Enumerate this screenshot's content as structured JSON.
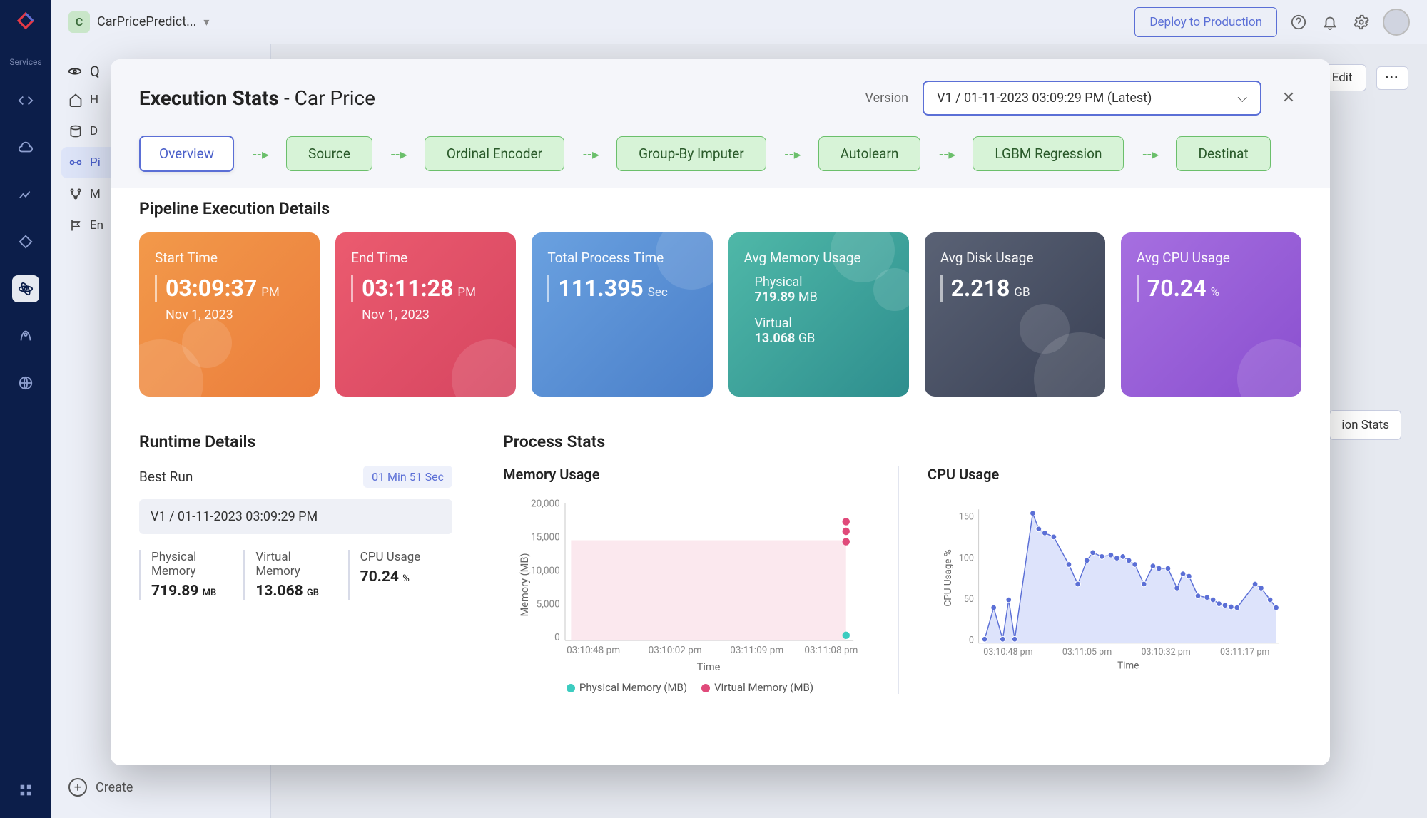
{
  "rail": {
    "services_label": "Services"
  },
  "topbar": {
    "project_initial": "C",
    "project_name": "CarPricePredict...",
    "deploy_label": "Deploy to Production"
  },
  "secnav": {
    "title": "Q",
    "items": [
      {
        "icon": "home",
        "label": "H"
      },
      {
        "icon": "data",
        "label": "D"
      },
      {
        "icon": "pipeline",
        "label": "Pi",
        "active": true
      },
      {
        "icon": "model",
        "label": "M"
      },
      {
        "icon": "endpoint",
        "label": "En"
      }
    ],
    "create_label": "Create"
  },
  "bg_controls": {
    "edit_label": "Edit",
    "stats_label": "ion Stats"
  },
  "modal": {
    "title_prefix": "Execution Stats",
    "title_suffix": "Car Price",
    "version_label": "Version",
    "version_value": "V1 / 01-11-2023 03:09:29 PM (Latest)",
    "tab_overview": "Overview",
    "pipeline": [
      "Source",
      "Ordinal Encoder",
      "Group-By Imputer",
      "Autolearn",
      "LGBM Regression",
      "Destinat"
    ],
    "section_title": "Pipeline Execution Details",
    "metrics": {
      "start": {
        "label": "Start Time",
        "value": "03:09:37",
        "unit": "PM",
        "sub": "Nov 1, 2023"
      },
      "end": {
        "label": "End Time",
        "value": "03:11:28",
        "unit": "PM",
        "sub": "Nov 1, 2023"
      },
      "process": {
        "label": "Total Process Time",
        "value": "111.395",
        "unit": "Sec"
      },
      "memory": {
        "label": "Avg Memory Usage",
        "phys_label": "Physical",
        "phys_value": "719.89",
        "phys_unit": "MB",
        "virt_label": "Virtual",
        "virt_value": "13.068",
        "virt_unit": "GB"
      },
      "disk": {
        "label": "Avg Disk Usage",
        "value": "2.218",
        "unit": "GB"
      },
      "cpu": {
        "label": "Avg CPU Usage",
        "value": "70.24",
        "unit": "%"
      }
    },
    "runtime": {
      "title": "Runtime Details",
      "best_run_label": "Best Run",
      "best_run_value": "01 Min 51 Sec",
      "version_chip": "V1 / 01-11-2023 03:09:29 PM",
      "phys_label": "Physical Memory",
      "phys_value": "719.89",
      "phys_unit": "MB",
      "virt_label": "Virtual Memory",
      "virt_value": "13.068",
      "virt_unit": "GB",
      "cpu_label": "CPU Usage",
      "cpu_value": "70.24",
      "cpu_unit": "%"
    },
    "process_stats": {
      "title": "Process Stats",
      "memory_title": "Memory Usage",
      "cpu_title": "CPU Usage",
      "legend_phys": "Physical Memory (MB)",
      "legend_virt": "Virtual Memory (MB)",
      "xlabel": "Time",
      "mem_ylabel": "Memory (MB)",
      "cpu_ylabel": "CPU Usage %"
    }
  },
  "chart_data": [
    {
      "type": "scatter",
      "title": "Memory Usage",
      "xlabel": "Time",
      "ylabel": "Memory (MB)",
      "x_categories": [
        "03:10:48 pm",
        "03:10:02 pm",
        "03:11:09 pm",
        "03:11:08 pm"
      ],
      "ylim": [
        0,
        20000
      ],
      "yticks": [
        0,
        5000,
        10000,
        15000,
        20000
      ],
      "series": [
        {
          "name": "Physical Memory (MB)",
          "color": "#3cccc0",
          "points": [
            {
              "x": "03:11:08 pm",
              "y": 700
            }
          ]
        },
        {
          "name": "Virtual Memory (MB)",
          "color": "#e04a7a",
          "points": [
            {
              "x": "03:11:08 pm",
              "y": 17500
            },
            {
              "x": "03:11:08 pm",
              "y": 16500
            },
            {
              "x": "03:11:08 pm",
              "y": 15000
            }
          ]
        }
      ],
      "shaded_region": {
        "x_from": "03:10:48 pm",
        "x_to": "03:11:08 pm",
        "y_from": 0,
        "y_to": 15000,
        "color": "#fbe8ee"
      }
    },
    {
      "type": "scatter",
      "title": "CPU Usage",
      "xlabel": "Time",
      "ylabel": "CPU Usage %",
      "x_categories": [
        "03:10:48 pm",
        "03:11:05 pm",
        "03:10:32 pm",
        "03:11:17 pm"
      ],
      "ylim": [
        0,
        170
      ],
      "yticks": [
        0,
        50,
        100,
        150
      ],
      "series": [
        {
          "name": "CPU Usage %",
          "color": "#5b6fd6",
          "points": [
            {
              "x": 0.02,
              "y": 5
            },
            {
              "x": 0.05,
              "y": 45
            },
            {
              "x": 0.08,
              "y": 5
            },
            {
              "x": 0.1,
              "y": 55
            },
            {
              "x": 0.12,
              "y": 5
            },
            {
              "x": 0.18,
              "y": 165
            },
            {
              "x": 0.2,
              "y": 145
            },
            {
              "x": 0.22,
              "y": 140
            },
            {
              "x": 0.25,
              "y": 135
            },
            {
              "x": 0.3,
              "y": 100
            },
            {
              "x": 0.33,
              "y": 75
            },
            {
              "x": 0.36,
              "y": 105
            },
            {
              "x": 0.38,
              "y": 115
            },
            {
              "x": 0.41,
              "y": 110
            },
            {
              "x": 0.44,
              "y": 112
            },
            {
              "x": 0.46,
              "y": 108
            },
            {
              "x": 0.48,
              "y": 110
            },
            {
              "x": 0.5,
              "y": 105
            },
            {
              "x": 0.52,
              "y": 100
            },
            {
              "x": 0.55,
              "y": 75
            },
            {
              "x": 0.58,
              "y": 98
            },
            {
              "x": 0.6,
              "y": 95
            },
            {
              "x": 0.63,
              "y": 95
            },
            {
              "x": 0.66,
              "y": 70
            },
            {
              "x": 0.68,
              "y": 88
            },
            {
              "x": 0.7,
              "y": 85
            },
            {
              "x": 0.73,
              "y": 60
            },
            {
              "x": 0.76,
              "y": 58
            },
            {
              "x": 0.78,
              "y": 55
            },
            {
              "x": 0.8,
              "y": 50
            },
            {
              "x": 0.82,
              "y": 48
            },
            {
              "x": 0.84,
              "y": 46
            },
            {
              "x": 0.86,
              "y": 45
            },
            {
              "x": 0.92,
              "y": 75
            },
            {
              "x": 0.94,
              "y": 70
            },
            {
              "x": 0.97,
              "y": 55
            },
            {
              "x": 0.99,
              "y": 45
            }
          ]
        }
      ]
    }
  ]
}
